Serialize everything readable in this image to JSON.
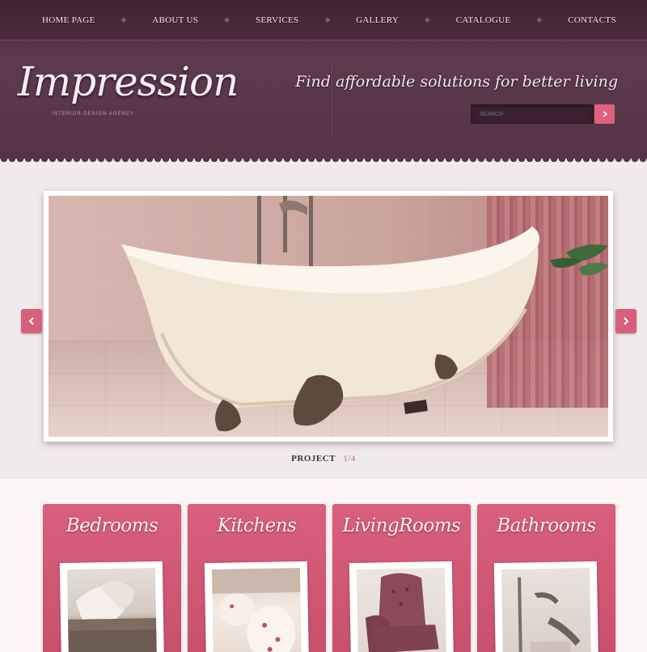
{
  "nav": {
    "items": [
      {
        "label": "HOME PAGE"
      },
      {
        "label": "ABOUT US"
      },
      {
        "label": "SERVICES"
      },
      {
        "label": "GALLERY"
      },
      {
        "label": "CATALOGUE"
      },
      {
        "label": "CONTACTS"
      }
    ]
  },
  "header": {
    "logo": "Impression",
    "logo_sub": "INTERIOR DESIGN AGENCY",
    "slogan": "Find affordable solutions for better living",
    "search_placeholder": "SEARCH"
  },
  "slider": {
    "project_word": "PROJECT",
    "project_count": "1/4"
  },
  "categories": [
    {
      "title": "Bedrooms"
    },
    {
      "title": "Kitchens"
    },
    {
      "title": "LivingRooms"
    },
    {
      "title": "Bathrooms"
    }
  ],
  "colors": {
    "header": "#553447",
    "accent": "#d8607c",
    "background": "#efebed"
  },
  "icons": {
    "search": "search-icon",
    "prev": "chevron-left-icon",
    "next": "chevron-right-icon"
  }
}
